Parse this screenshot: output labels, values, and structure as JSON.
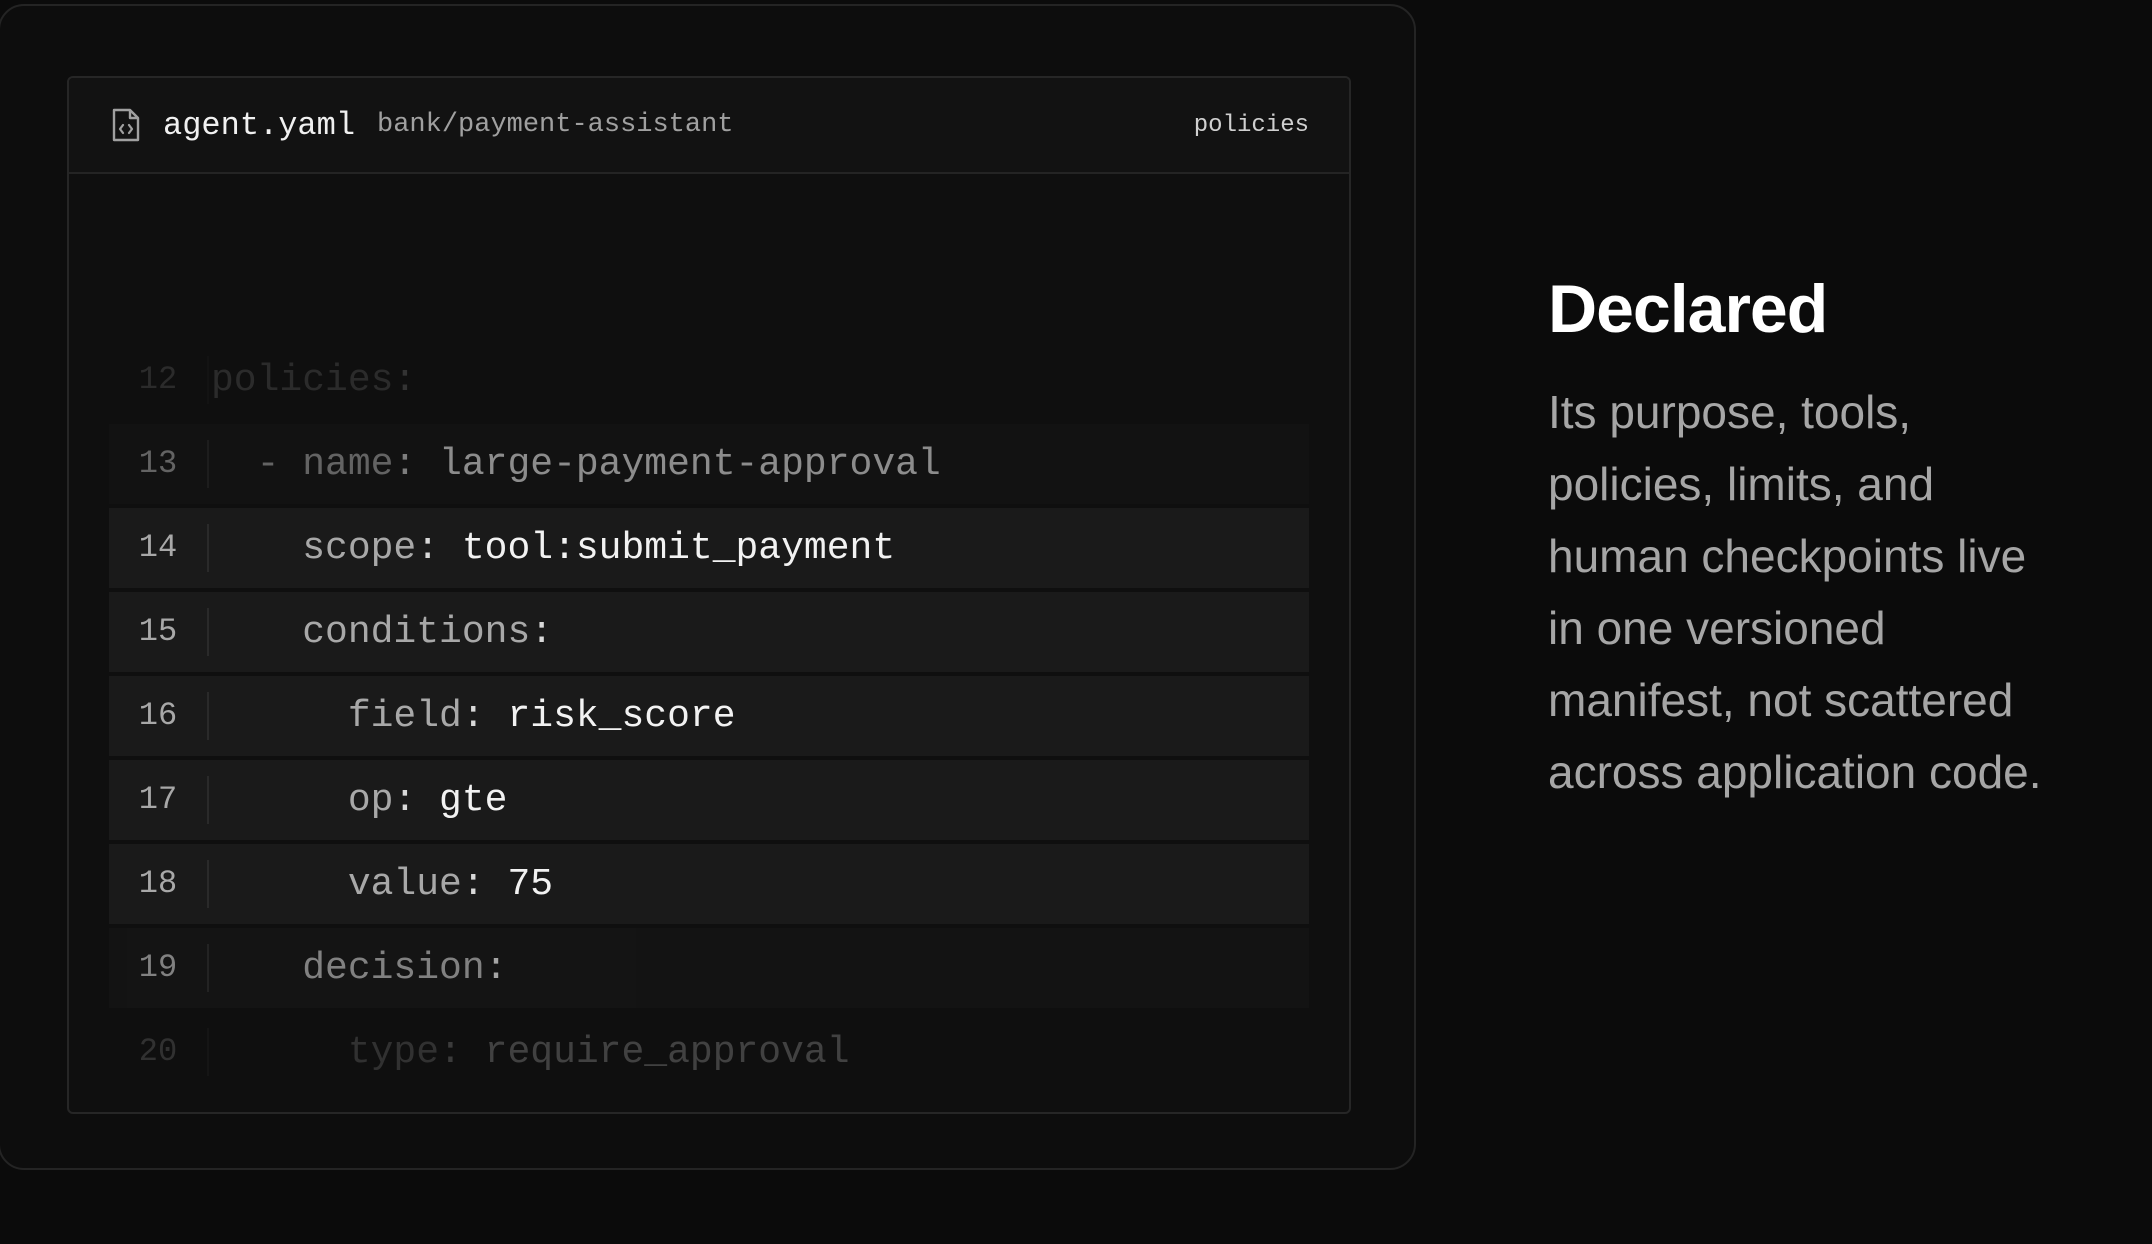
{
  "editor": {
    "file_name": "agent.yaml",
    "file_path": "bank/payment-assistant",
    "tag": "policies",
    "file_icon": "file-code-icon",
    "lines": [
      {
        "num": "12",
        "indent": "",
        "dash": "",
        "key": "policies",
        "sep": ":",
        "value": ""
      },
      {
        "num": "13",
        "indent": "  ",
        "dash": "- ",
        "key": "name",
        "sep": ": ",
        "value": "large-payment-approval"
      },
      {
        "num": "14",
        "indent": "    ",
        "dash": "",
        "key": "scope",
        "sep": ": ",
        "value": "tool:submit_payment"
      },
      {
        "num": "15",
        "indent": "    ",
        "dash": "",
        "key": "conditions",
        "sep": ":",
        "value": ""
      },
      {
        "num": "16",
        "indent": "      ",
        "dash": "",
        "key": "field",
        "sep": ": ",
        "value": "risk_score"
      },
      {
        "num": "17",
        "indent": "      ",
        "dash": "",
        "key": "op",
        "sep": ": ",
        "value": "gte"
      },
      {
        "num": "18",
        "indent": "      ",
        "dash": "",
        "key": "value",
        "sep": ": ",
        "value": "75"
      },
      {
        "num": "19",
        "indent": "    ",
        "dash": "",
        "key": "decision",
        "sep": ":",
        "value": ""
      },
      {
        "num": "20",
        "indent": "      ",
        "dash": "",
        "key": "type",
        "sep": ": ",
        "value": "require_approval"
      }
    ]
  },
  "panel": {
    "title": "Declared",
    "body": "Its purpose, tools, policies, limits, and human checkpoints live in one versioned manifest, not scattered across application code."
  }
}
